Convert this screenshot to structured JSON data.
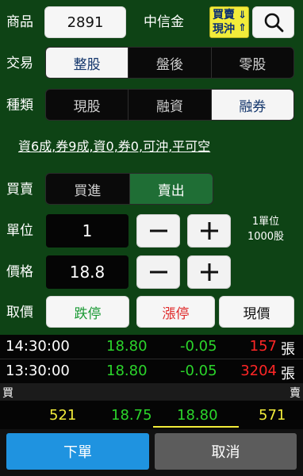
{
  "product": {
    "label": "商品",
    "code": "2891",
    "name": "中信金",
    "daytrade_badge": [
      "買賣",
      "現沖"
    ],
    "search_icon": "search-icon"
  },
  "trade": {
    "label": "交易",
    "options": [
      "整股",
      "盤後",
      "零股"
    ],
    "selected": "整股"
  },
  "kind": {
    "label": "種類",
    "options": [
      "現股",
      "融資",
      "融券"
    ],
    "selected": "融券"
  },
  "info_line": "資6成,券9成,資0,券0,可沖,平可空",
  "side": {
    "label": "買賣",
    "options": [
      "買進",
      "賣出"
    ],
    "selected": "賣出"
  },
  "unit": {
    "label": "單位",
    "value": "1",
    "note_1": "1單位",
    "note_2": "1000股"
  },
  "price": {
    "label": "價格",
    "value": "18.8"
  },
  "fetch": {
    "label": "取價",
    "limit_down": "跌停",
    "limit_up": "漲停",
    "current": "現價"
  },
  "ticks": [
    {
      "time": "14:30:00",
      "price": "18.80",
      "change": "-0.05",
      "volume": "157",
      "unit": "張"
    },
    {
      "time": "13:30:00",
      "price": "18.80",
      "change": "-0.05",
      "volume": "3204",
      "unit": "張"
    }
  ],
  "book": {
    "buy_label": "買",
    "sell_label": "賣",
    "bid_qty": "521",
    "bid_price": "18.75",
    "ask_price": "18.80",
    "ask_qty": "571"
  },
  "actions": {
    "submit": "下單",
    "cancel": "取消"
  },
  "colors": {
    "background": "#0e4315",
    "green": "#2bd52b",
    "red": "#ff2626",
    "yellow": "#f2ec3a",
    "submit_blue": "#1f93e0",
    "cancel_gray": "#5c5c5c",
    "selected_text": "#12356b"
  }
}
